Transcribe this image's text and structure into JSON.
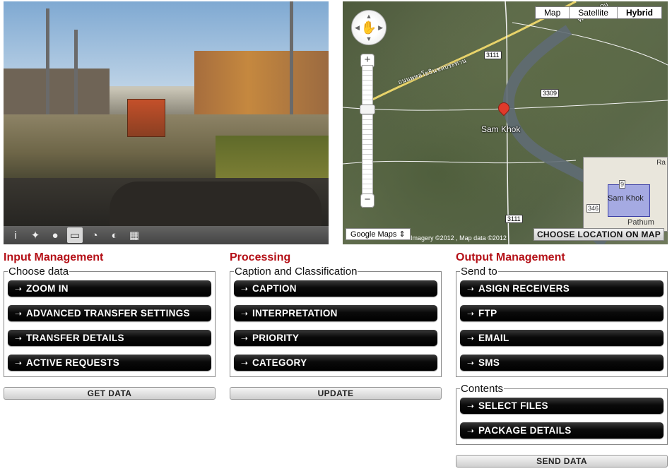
{
  "photo_toolbar": {
    "tools": [
      {
        "name": "info-icon",
        "glyph": "i"
      },
      {
        "name": "compass-icon",
        "glyph": "✦"
      },
      {
        "name": "person-icon",
        "glyph": "●"
      },
      {
        "name": "rectangle-tool-icon",
        "glyph": "▭"
      },
      {
        "name": "speedometer-icon",
        "glyph": "◔"
      },
      {
        "name": "tag-icon",
        "glyph": "◐"
      },
      {
        "name": "stamp-icon",
        "glyph": "▦"
      }
    ]
  },
  "map": {
    "type_buttons": [
      "Map",
      "Satellite",
      "Hybrid"
    ],
    "active_type": "Hybrid",
    "pin_label": "Sam Khok",
    "road_name": "ถนนพหลโยธินชลประทาน",
    "road_badges": [
      "3111",
      "3309",
      "3111"
    ],
    "overview": {
      "label": "Sam Khok",
      "city": "Pathum",
      "badge1": "346",
      "badge2": "9",
      "corner": "Ra"
    },
    "source_select": "Google Maps",
    "attribution": "Imagery ©2012 , Map data ©2012",
    "choose_location": "CHOOSE LOCATION ON MAP",
    "zoom_in": "+",
    "zoom_out": "−",
    "road_label_top": "Western Ou"
  },
  "input": {
    "title": "Input Management",
    "legend": "Choose data",
    "buttons": [
      "ZOOM IN",
      "ADVANCED TRANSFER SETTINGS",
      "TRANSFER DETAILS",
      "ACTIVE REQUESTS"
    ],
    "action": "GET DATA"
  },
  "processing": {
    "title": "Processing",
    "legend": "Caption and Classification",
    "buttons": [
      "CAPTION",
      "INTERPRETATION",
      "PRIORITY",
      "CATEGORY"
    ],
    "action": "UPDATE"
  },
  "output": {
    "title": "Output Management",
    "send_legend": "Send to",
    "send_buttons": [
      "ASIGN RECEIVERS",
      "FTP",
      "EMAIL",
      "SMS"
    ],
    "contents_legend": "Contents",
    "contents_buttons": [
      "SELECT FILES",
      "PACKAGE DETAILS"
    ],
    "action": "SEND DATA"
  },
  "colors": {
    "section_title": "#b40f16",
    "button_bg": "#000000",
    "button_text": "#ffffff"
  }
}
